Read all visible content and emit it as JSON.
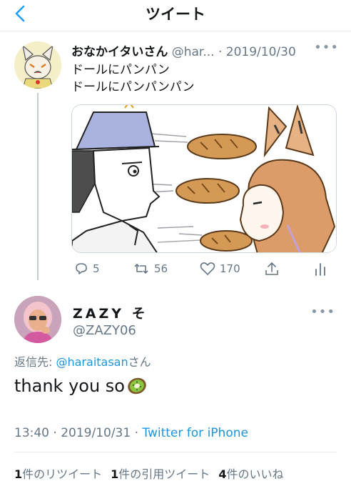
{
  "header": {
    "title": "ツイート"
  },
  "parent_tweet": {
    "name": "おなかイタいさん",
    "handle": "@har...",
    "date": "· 2019/10/30",
    "more": "•••",
    "lines": [
      "ドールにパンパン",
      "ドールにパンパンパン"
    ],
    "actions": {
      "replies": "5",
      "retweets": "56",
      "likes": "170"
    }
  },
  "reply": {
    "name": "ZAZY",
    "name_suffix": "そ",
    "handle": "@ZAZY06",
    "more": "•••",
    "reply_to_prefix": "返信先: ",
    "reply_to_handle": "@haraitasan",
    "reply_to_suffix": "さん",
    "text": "thank you so",
    "time": "13:40 · 2019/10/31 · ",
    "app": "Twitter for iPhone"
  },
  "stats": {
    "retweets_count": "1",
    "retweets_label": "件のリツイート",
    "quotes_count": "1",
    "quotes_label": "件の引用ツイート",
    "likes_count": "4",
    "likes_label": "件のいいね"
  },
  "colors": {
    "link": "#1b95e0",
    "muted": "#657786",
    "divider": "#e6ecf0"
  }
}
